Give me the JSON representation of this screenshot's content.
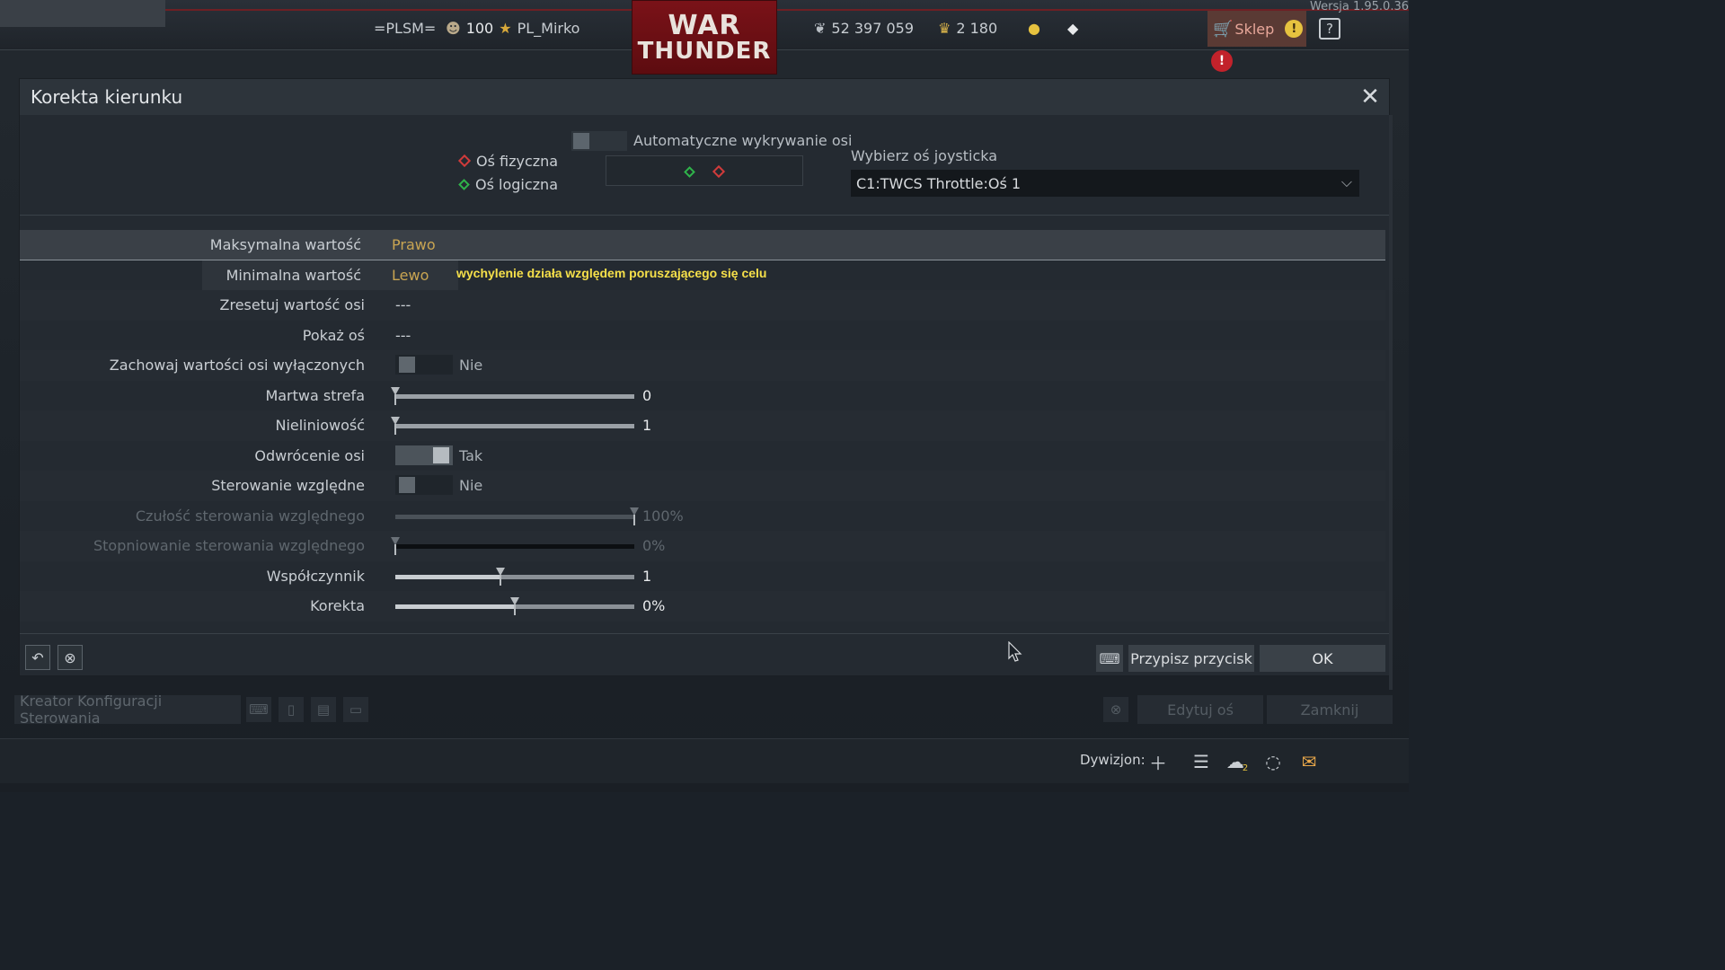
{
  "version": "Wersja 1.95.0.36",
  "topbar": {
    "squad": "=PLSM=",
    "level": "100",
    "username": "PL_Mirko",
    "logo_line1": "WAR",
    "logo_line2": "THUNDER",
    "silver_lions": "52 397 059",
    "golden_eagles": "2 180",
    "shop_label": "Sklep",
    "help_label": "?"
  },
  "dialog": {
    "title": "Korekta kierunku",
    "legend_physical": "Oś fizyczna",
    "legend_logical": "Oś logiczna",
    "auto_detect_label": "Automatyczne wykrywanie osi",
    "joystick_label": "Wybierz oś joysticka",
    "joystick_value": "C1:TWCS Throttle:Oś 1",
    "hint": "wychylenie działa względem poruszającego się celu",
    "rows": {
      "max": {
        "label": "Maksymalna wartość",
        "value": "Prawo"
      },
      "min": {
        "label": "Minimalna wartość",
        "value": "Lewo"
      },
      "reset": {
        "label": "Zresetuj wartość osi",
        "value": "---"
      },
      "show": {
        "label": "Pokaż oś",
        "value": "---"
      },
      "keep": {
        "label": "Zachowaj wartości osi wyłączonych",
        "value": "Nie",
        "on": false
      },
      "deadzone": {
        "label": "Martwa strefa",
        "value": "0",
        "level": 0
      },
      "nonlinearity": {
        "label": "Nieliniowość",
        "value": "1",
        "level": 0
      },
      "invert": {
        "label": "Odwrócenie osi",
        "value": "Tak",
        "on": true
      },
      "relative": {
        "label": "Sterowanie względne",
        "value": "Nie",
        "on": false
      },
      "rel_sensitivity": {
        "label": "Czułość sterowania względnego",
        "value": "100%",
        "level": 1.0
      },
      "rel_step": {
        "label": "Stopniowanie sterowania względnego",
        "value": "0%",
        "level": 0
      },
      "multiplier": {
        "label": "Współczynnik",
        "value": "1",
        "level": 0.44
      },
      "correction": {
        "label": "Korekta",
        "value": "0%",
        "level": 0.5
      }
    },
    "assign_button": "Przypisz przycisk",
    "ok_button": "OK"
  },
  "parent": {
    "wizard": "Kreator Konfiguracji Sterowania",
    "edit_axis": "Edytuj oś",
    "close": "Zamknij"
  },
  "statusbar": {
    "squadron_label": "Dywizjon:",
    "contacts_count": "2"
  }
}
